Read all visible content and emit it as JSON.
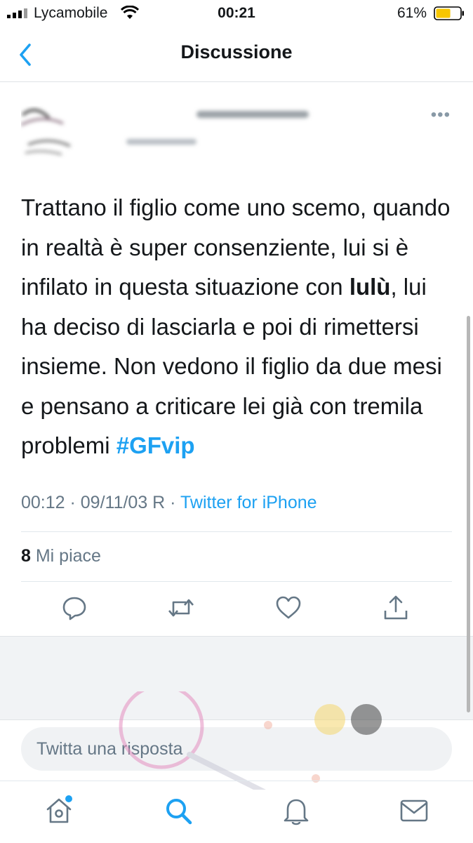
{
  "status_bar": {
    "carrier": "Lycamobile",
    "time": "00:21",
    "battery": "61%",
    "battery_level": 0.61,
    "battery_color": "#f7c600"
  },
  "nav": {
    "back_icon": "chevron-left-icon",
    "title": "Discussione"
  },
  "tweet": {
    "more_icon": "more-horizontal-icon",
    "text_part1": "Trattano il figlio come uno scemo, quando in realtà è super consenziente, lui si è infilato in questa situazione con ",
    "text_bold": "lulù",
    "text_part2": ", lui ha deciso di lasciarla e poi di rimettersi insieme. Non vedono il figlio da due mesi e pensano a criticare lei già con tremila problemi ",
    "hashtag": "#GFvip",
    "timestamp": "00:12 · 09/11/03 R · ",
    "source": "Twitter for iPhone",
    "likes_count": "8",
    "likes_label": "Mi piace"
  },
  "actions": {
    "reply_icon": "reply-icon",
    "retweet_icon": "retweet-icon",
    "like_icon": "heart-icon",
    "share_icon": "share-icon"
  },
  "reply": {
    "placeholder": "Twitta una risposta"
  },
  "tabs": {
    "home_icon": "home-icon",
    "search_icon": "search-icon",
    "notifications_icon": "bell-icon",
    "messages_icon": "mail-icon"
  },
  "colors": {
    "accent": "#1da1f2",
    "secondary_text": "#657786",
    "primary_text": "#14171a"
  }
}
